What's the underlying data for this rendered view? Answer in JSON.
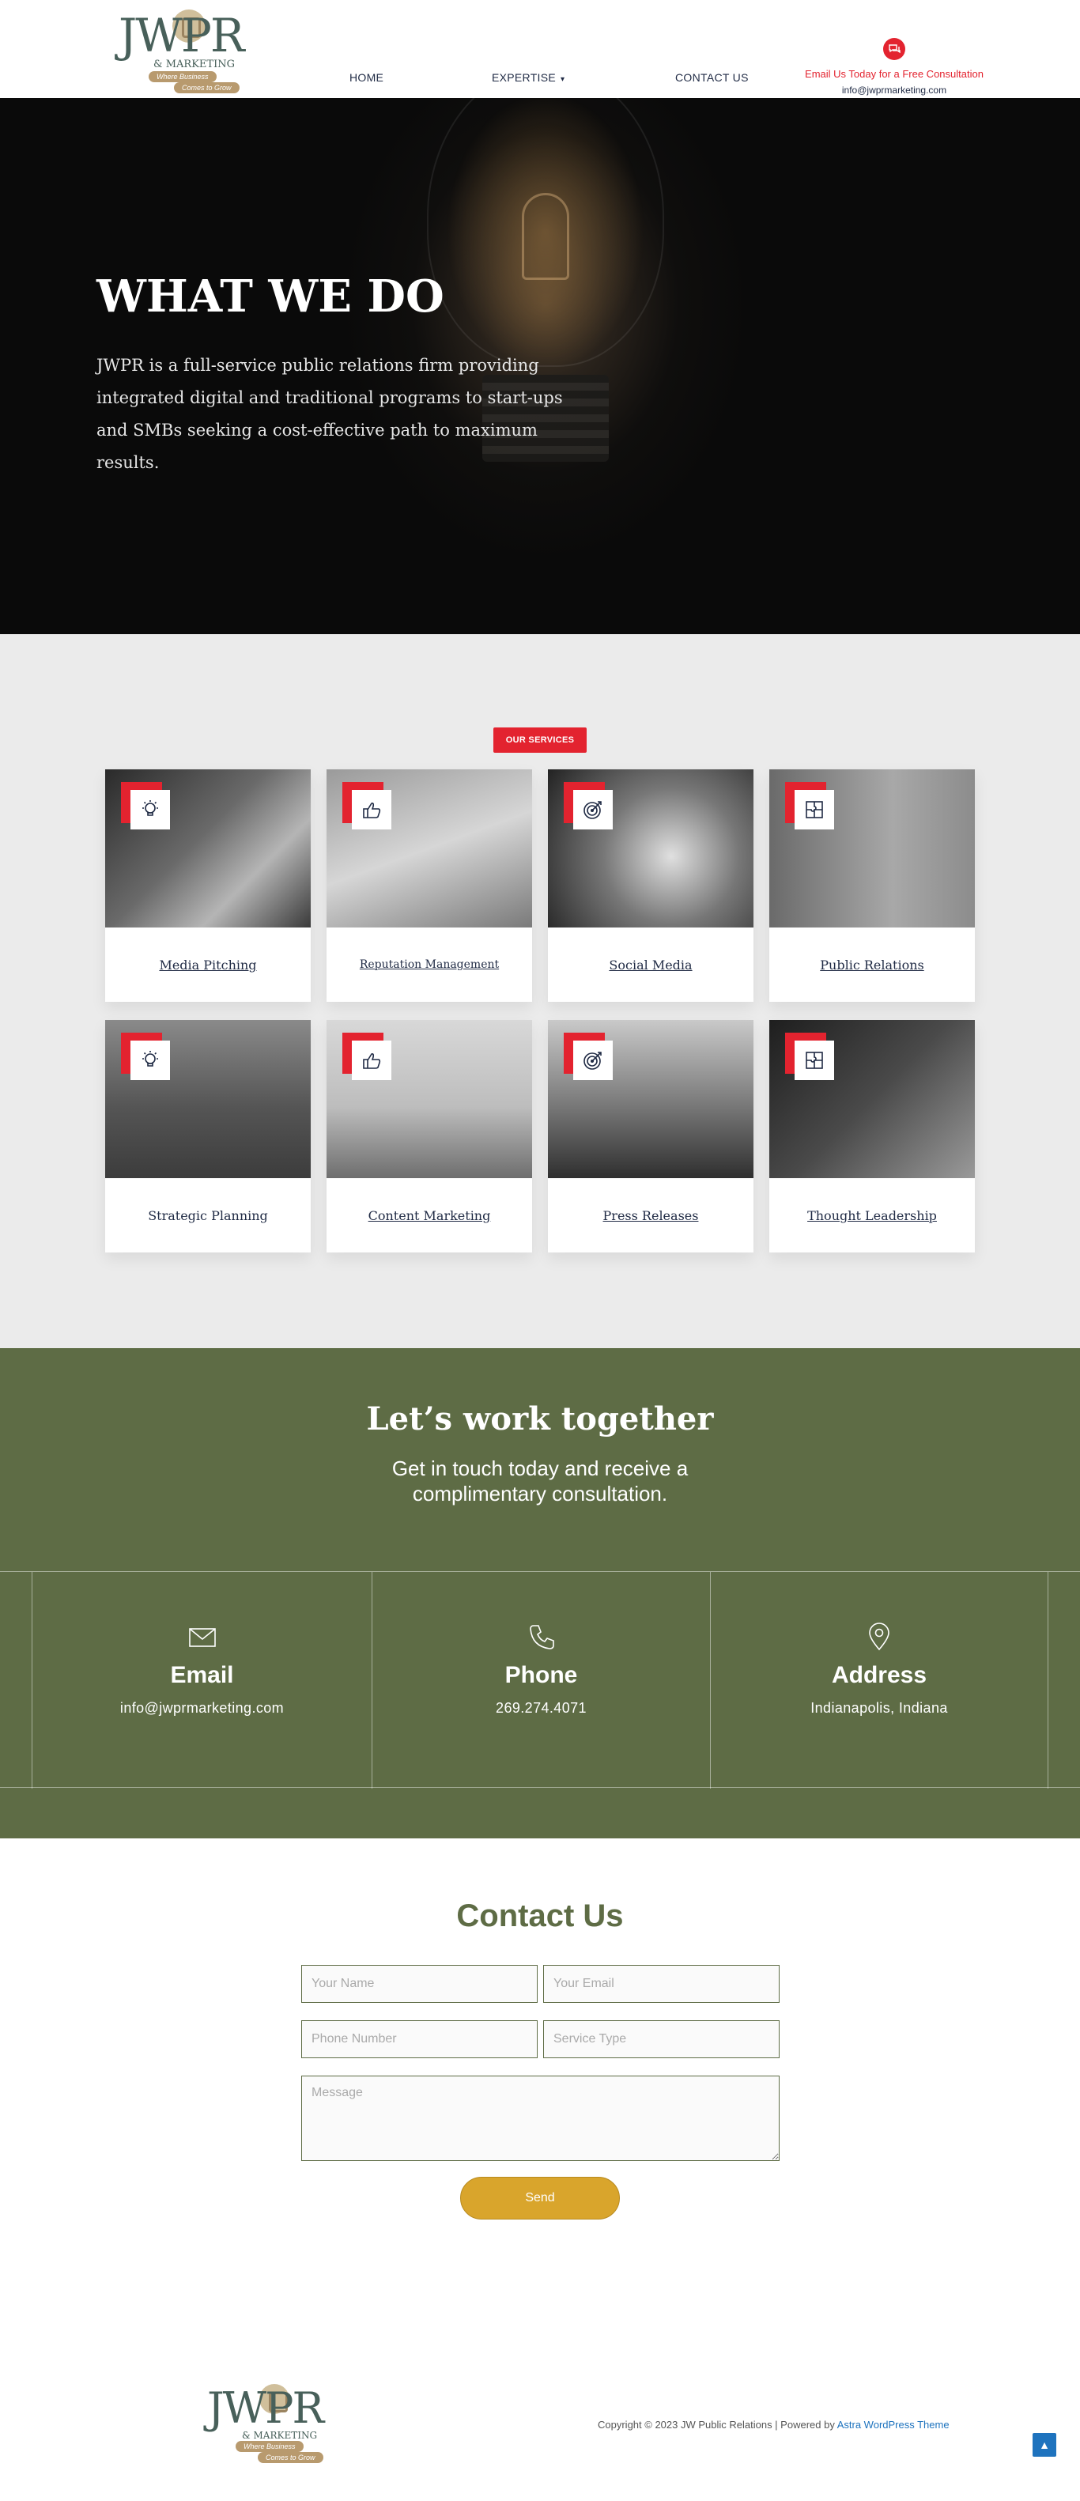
{
  "header": {
    "logo": {
      "text": "JWPR",
      "sub": "& MARKETING",
      "tagline1": "Where Business",
      "tagline2": "Comes to Grow"
    },
    "nav": {
      "home": "HOME",
      "expertise": "EXPERTISE",
      "contact": "CONTACT US"
    },
    "cta": {
      "line1": "Email Us Today for a Free Consultation",
      "line2": "info@jwprmarketing.com"
    }
  },
  "hero": {
    "title": "WHAT WE DO",
    "text": "JWPR is a full-service public relations firm providing integrated digital and traditional programs to start-ups and SMBs seeking a cost-effective path to maximum results."
  },
  "services": {
    "badge": "OUR SERVICES",
    "items": [
      {
        "label": "Media Pitching",
        "icon": "lightbulb-icon"
      },
      {
        "label": "Reputation Management",
        "icon": "thumbs-up-icon"
      },
      {
        "label": "Social Media",
        "icon": "target-icon"
      },
      {
        "label": "Public Relations",
        "icon": "puzzle-icon"
      },
      {
        "label": "Strategic Planning",
        "icon": "lightbulb-icon"
      },
      {
        "label": "Content Marketing",
        "icon": "thumbs-up-icon"
      },
      {
        "label": "Press Releases",
        "icon": "target-icon"
      },
      {
        "label": "Thought Leadership",
        "icon": "puzzle-icon"
      }
    ]
  },
  "together": {
    "title": "Let’s work together",
    "subtitle": "Get in touch today and receive a complimentary consultation.",
    "email": {
      "head": "Email",
      "value": "info@jwprmarketing.com"
    },
    "phone": {
      "head": "Phone",
      "value": "269.274.4071"
    },
    "address": {
      "head": "Address",
      "value": "Indianapolis, Indiana"
    }
  },
  "contact": {
    "title": "Contact Us",
    "name_placeholder": "Your Name",
    "email_placeholder": "Your Email",
    "phone_placeholder": "Phone Number",
    "service_placeholder": "Service Type",
    "message_placeholder": "Message",
    "send_label": "Send"
  },
  "footer": {
    "copyright": "Copyright © 2023 JW Public Relations | Powered by ",
    "theme_link": "Astra WordPress Theme",
    "scroll_top": "▲"
  },
  "colors": {
    "accent_red": "#e3232f",
    "olive": "#5e6c45",
    "gold": "#d9a52c",
    "navy": "#1f2a44"
  }
}
